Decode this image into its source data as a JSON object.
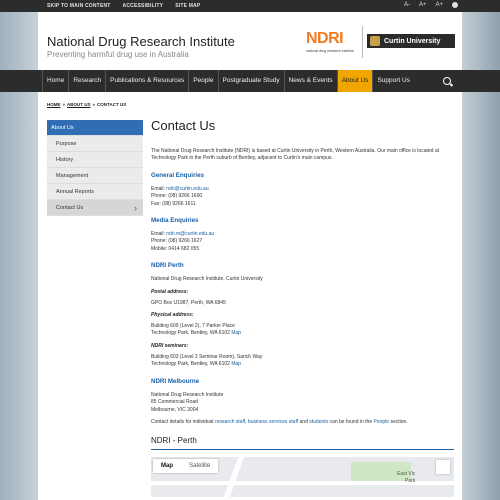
{
  "utility": {
    "links": [
      "SKIP TO MAIN CONTENT",
      "ACCESSIBILITY",
      "SITE MAP"
    ],
    "font_controls": [
      "A-",
      "A+",
      "A+"
    ]
  },
  "header": {
    "title": "National Drug Research Institute",
    "tagline": "Preventing harmful drug use in Australia",
    "ndri_logo": "NDRI",
    "ndri_logo_sub": "national drug research institute",
    "curtin_logo": "Curtin University"
  },
  "nav": {
    "items": [
      "Home",
      "Research",
      "Publications & Resources",
      "People",
      "Postgraduate Study",
      "News & Events",
      "About Us",
      "Support Us"
    ],
    "active_index": 6
  },
  "breadcrumb": [
    "HOME",
    "ABOUT US",
    "CONTACT US"
  ],
  "sidebar": {
    "items": [
      "About Us",
      "Purpose",
      "History",
      "Management",
      "Annual Reports",
      "Contact Us"
    ]
  },
  "content": {
    "title": "Contact Us",
    "intro": "The National Drug Research Institute (NDRI) is based at Curtin University in Perth, Western Australia. Our main office is located at Technology Park in the Perth suburb of Bentley, adjacent to Curtin's main campus.",
    "general": {
      "heading": "General Enquiries",
      "email_label": "Email: ",
      "email": "ndri@curtin.edu.au",
      "phone": "Phone: (08) 9266 1600",
      "fax": "Fax: (08) 9266 1611"
    },
    "media": {
      "heading": "Media Enquiries",
      "email_label": "Email: ",
      "email": "ndri.m@curtin.edu.au",
      "phone": "Phone: (08) 9266 1627",
      "mobile": "Mobile: 0414 682 055"
    },
    "perth": {
      "heading": "NDRI Perth",
      "org": "National Drug Research Institute, Curtin University",
      "postal_label": "Postal address:",
      "postal": "GPO Box U1987, Perth, WA 6845",
      "physical_label": "Physical address:",
      "physical1": "Building 609 (Level 2), 7 Parker Place",
      "physical2": "Technology Park, Bentley, WA 6102 ",
      "map_link": "Map",
      "seminars_label": "NDRI seminars:",
      "seminars1": "Building 603 (Level 2 Seminar Room), Sarich Way",
      "seminars2": "Technology Park, Bentley, WA 6102 ",
      "seminars_map_link": "Map"
    },
    "melbourne": {
      "heading": "NDRI Melbourne",
      "line1": "National Drug Research Institute",
      "line2": "85 Commercial Road",
      "line3": "Melbourne, VIC 3004"
    },
    "staff": {
      "prefix": "Contact details for individual ",
      "link1": "research staff",
      "sep1": ", ",
      "link2": "business services staff",
      "sep2": " and ",
      "link3": "students",
      "mid": " can be found in the ",
      "link4": "People",
      "suffix": " section."
    },
    "map": {
      "title": "NDRI - Perth",
      "tab_map": "Map",
      "tab_satellite": "Satellite",
      "label1": "East Vic",
      "label2": "Park"
    }
  }
}
